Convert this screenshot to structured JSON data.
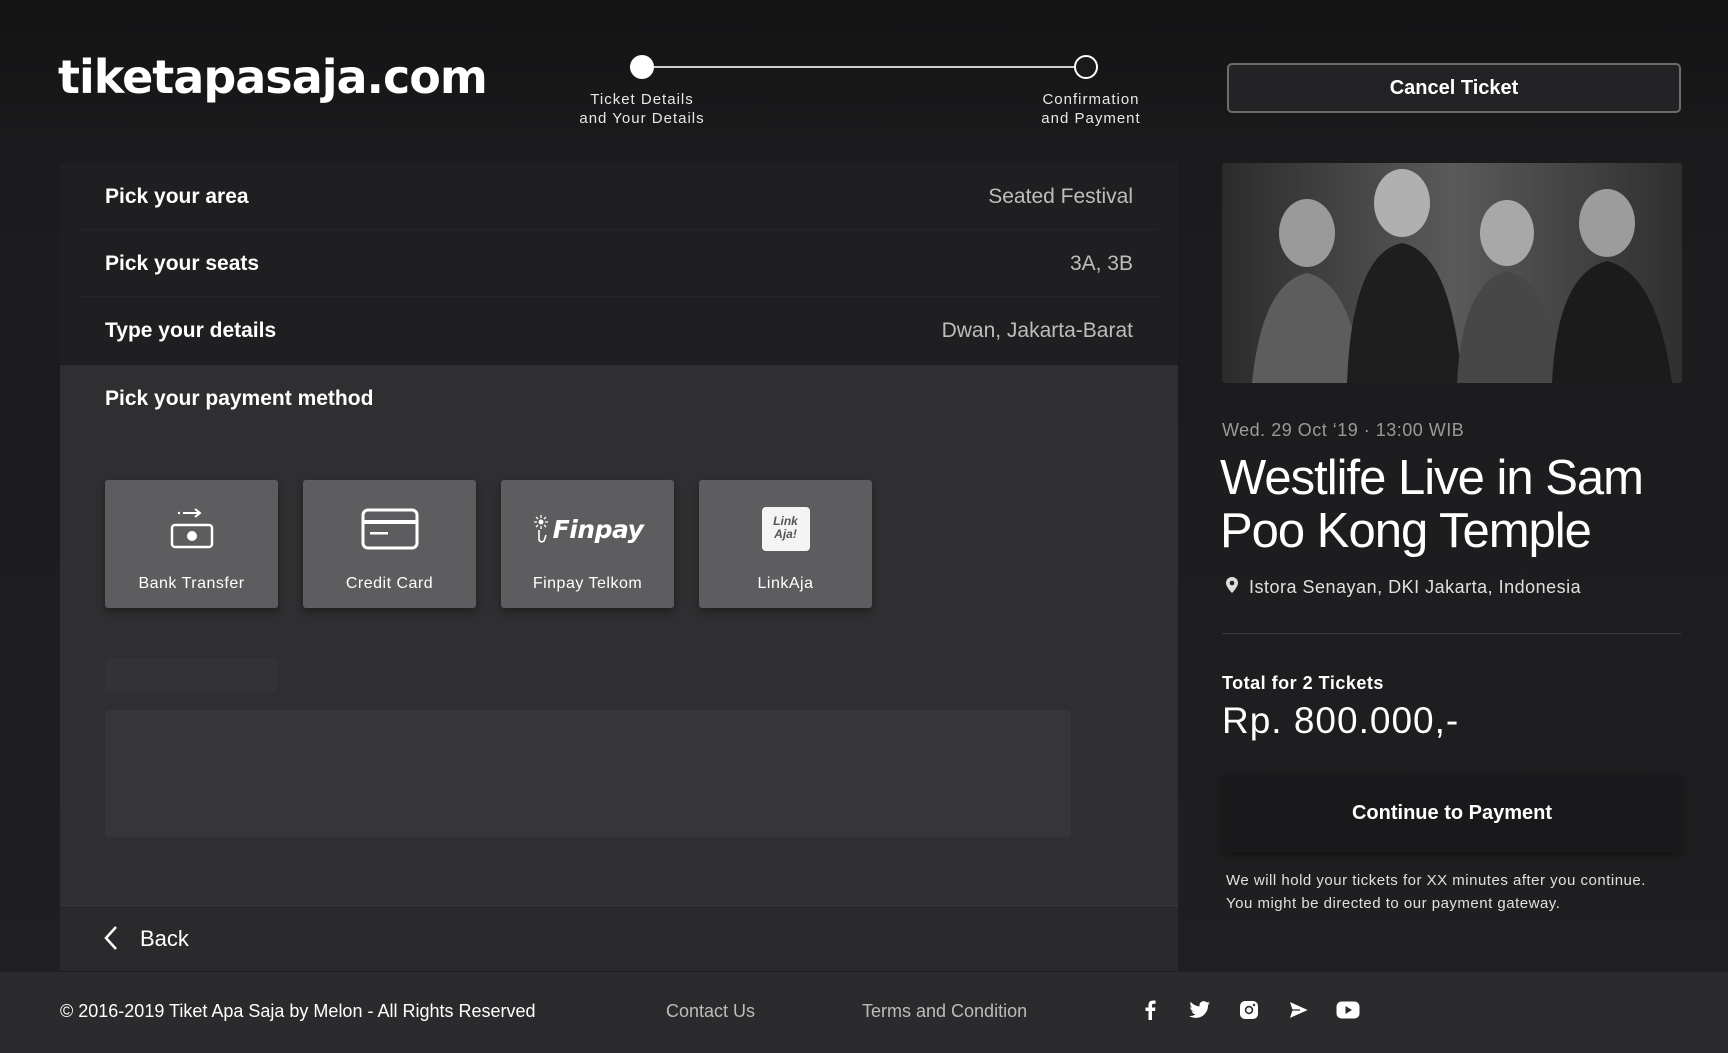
{
  "brand": {
    "logo_text": "tiketapasaja.com"
  },
  "stepper": {
    "steps": [
      {
        "label": "Ticket Details\nand Your Details",
        "state": "done"
      },
      {
        "label": "Confirmation\nand Payment",
        "state": "pending"
      }
    ]
  },
  "header": {
    "cancel_label": "Cancel Ticket"
  },
  "form": {
    "rows": [
      {
        "label": "Pick your area",
        "value": "Seated Festival"
      },
      {
        "label": "Pick your seats",
        "value": "3A, 3B"
      },
      {
        "label": "Type your details",
        "value": "Dwan, Jakarta-Barat"
      }
    ],
    "payment_title": "Pick your payment method",
    "payment_options": [
      {
        "label": "Bank Transfer",
        "icon": "bank-transfer-icon"
      },
      {
        "label": "Credit Card",
        "icon": "credit-card-icon"
      },
      {
        "label": "Finpay Telkom",
        "icon": "finpay-logo",
        "logo_text": "Finpay"
      },
      {
        "label": "LinkAja",
        "icon": "linkaja-logo",
        "logo_text": "Link Aja!"
      }
    ],
    "back_label": "Back"
  },
  "event": {
    "date": "Wed. 29 Oct ‘19  ·  13:00 WIB",
    "title": "Westlife Live in Sam Poo Kong Temple",
    "location": "Istora Senayan, DKI Jakarta, Indonesia",
    "total_label": "Total for 2 Tickets",
    "total_value": "Rp. 800.000,-",
    "continue_label": "Continue to Payment",
    "hold_note_line1": "We will hold your tickets for XX minutes after you continue.",
    "hold_note_line2": "You might be directed to our payment gateway."
  },
  "footer": {
    "copyright": "© 2016-2019 Tiket Apa Saja by Melon - All Rights Reserved",
    "links": [
      "Contact Us",
      "Terms and Condition"
    ],
    "social": [
      "facebook-icon",
      "twitter-icon",
      "instagram-icon",
      "telegram-icon",
      "youtube-icon"
    ]
  },
  "colors": {
    "background": "#1b1b1d",
    "panel": "#1f1f21",
    "payment_section": "#2f2f31",
    "payment_card": "#5d5d5f",
    "footer": "#2b2b2d"
  }
}
